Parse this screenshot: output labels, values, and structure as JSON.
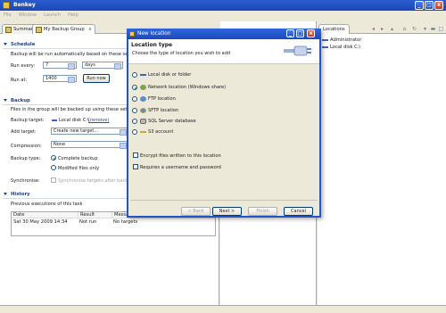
{
  "window": {
    "title": "Benkey",
    "min": "_",
    "max": "□",
    "close": "x"
  },
  "menu": [
    "File",
    "Window",
    "Launch",
    "Help"
  ],
  "editor_tabs": [
    {
      "label": "Summary"
    },
    {
      "label": "My Backup Group",
      "close": "x"
    }
  ],
  "schedule": {
    "header": "Schedule",
    "desc": "Backup will be run automatically based on these settings:",
    "run_every_label": "Run every:",
    "run_every_value": "7",
    "unit_value": "days",
    "run_at_label": "Run at:",
    "run_at_value": "1400",
    "run_now": "Run now"
  },
  "backup": {
    "header": "Backup",
    "desc": "Files in the group will be backed up using these settings:",
    "target_label": "Backup target:",
    "target_value": "Local disk C:\\",
    "remove": "(remove)",
    "add_target_label": "Add target:",
    "add_target_value": "Create new target...",
    "compression_label": "Compression:",
    "compression_value": "None",
    "type_label": "Backup type:",
    "type_complete": "Complete backup",
    "type_modified": "Modified files only",
    "sync_label": "Synchronise:",
    "sync_text": "Synchronise targets after backup"
  },
  "history": {
    "header": "History",
    "desc": "Previous executions of this task",
    "columns": [
      "Date",
      "Result",
      "Message"
    ],
    "rows": [
      {
        "date": "Sat 30 May 2009 14:34",
        "result": "Not run",
        "message": "No targets"
      }
    ]
  },
  "locations_panel": {
    "tab": "Locations",
    "items": [
      "Administrator",
      "Local disk C:\\"
    ]
  },
  "dialog": {
    "title": "New location",
    "heading": "Location type",
    "desc": "Choose the type of location you wish to add",
    "options": [
      {
        "label": "Local disk or folder",
        "icon": "disk-icon",
        "selected": false
      },
      {
        "label": "Network location (Windows share)",
        "icon": "network-icon",
        "selected": true
      },
      {
        "label": "FTP location",
        "icon": "globe-icon",
        "selected": false
      },
      {
        "label": "SFTP location",
        "icon": "globe-lock-icon",
        "selected": false
      },
      {
        "label": "SQL Server database",
        "icon": "database-icon",
        "selected": false
      },
      {
        "label": "S3 account",
        "icon": "key-icon",
        "selected": false
      }
    ],
    "encrypt": "Encrypt files written to this location",
    "require_login": "Requires a username and password",
    "buttons": {
      "back": "< Back",
      "next": "Next >",
      "finish": "Finish",
      "cancel": "Cancel"
    }
  }
}
